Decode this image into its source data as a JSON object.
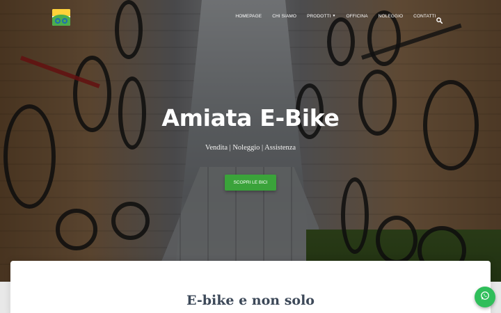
{
  "navbar": {
    "logo_icon": "e-bike-logo",
    "menu": [
      {
        "label": "Homepage"
      },
      {
        "label": "Chi siamo"
      },
      {
        "label": "Prodotti",
        "dropdown": true
      },
      {
        "label": "Officina"
      },
      {
        "label": "Noleggio"
      },
      {
        "label": "Contatti"
      }
    ],
    "search_icon": "search-icon"
  },
  "hero": {
    "title": "Amiata E-Bike",
    "subtitle": "Vendita | Noleggio | Assistenza",
    "cta_label": "Scopri le bici",
    "cta_color": "#3aa33a"
  },
  "content": {
    "section_title": "E-bike e non solo"
  },
  "floating": {
    "whatsapp_icon": "whatsapp-icon",
    "whatsapp_color": "#2fbe5a"
  }
}
